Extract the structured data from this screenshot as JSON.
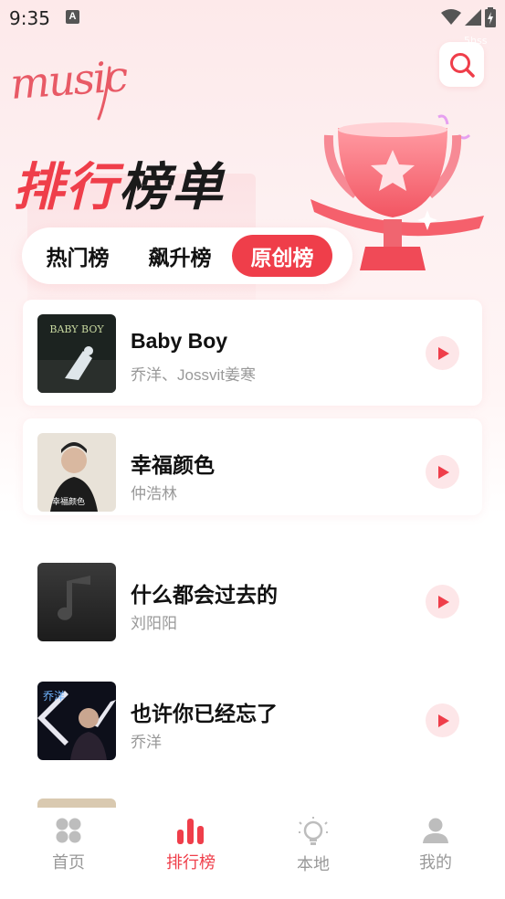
{
  "status_bar": {
    "time": "9:35",
    "notification_letter": "A"
  },
  "header": {
    "logo_text": "music",
    "watermark": "5hss",
    "title_part1": "排行",
    "title_part2": "榜单"
  },
  "tabs": [
    {
      "label": "热门榜",
      "active": false
    },
    {
      "label": "飙升榜",
      "active": false
    },
    {
      "label": "原创榜",
      "active": true
    }
  ],
  "songs": [
    {
      "title": "Baby Boy",
      "artist": "乔洋、Jossvit姜寒",
      "cover_text": "BABY BOY"
    },
    {
      "title": "幸福颜色",
      "artist": "仲浩林",
      "cover_text": "幸福颜色"
    },
    {
      "title": "什么都会过去的",
      "artist": "刘阳阳",
      "cover_text": ""
    },
    {
      "title": "也许你已经忘了",
      "artist": "乔洋",
      "cover_text": "乔洋"
    }
  ],
  "bottom_nav": [
    {
      "label": "首页",
      "icon": "home-grid-icon",
      "active": false
    },
    {
      "label": "排行榜",
      "icon": "bar-chart-icon",
      "active": true
    },
    {
      "label": "本地",
      "icon": "lightbulb-icon",
      "active": false
    },
    {
      "label": "我的",
      "icon": "user-icon",
      "active": false
    }
  ],
  "colors": {
    "accent": "#ef3e4a",
    "accent_light": "#fde6e8",
    "muted": "#999999"
  }
}
